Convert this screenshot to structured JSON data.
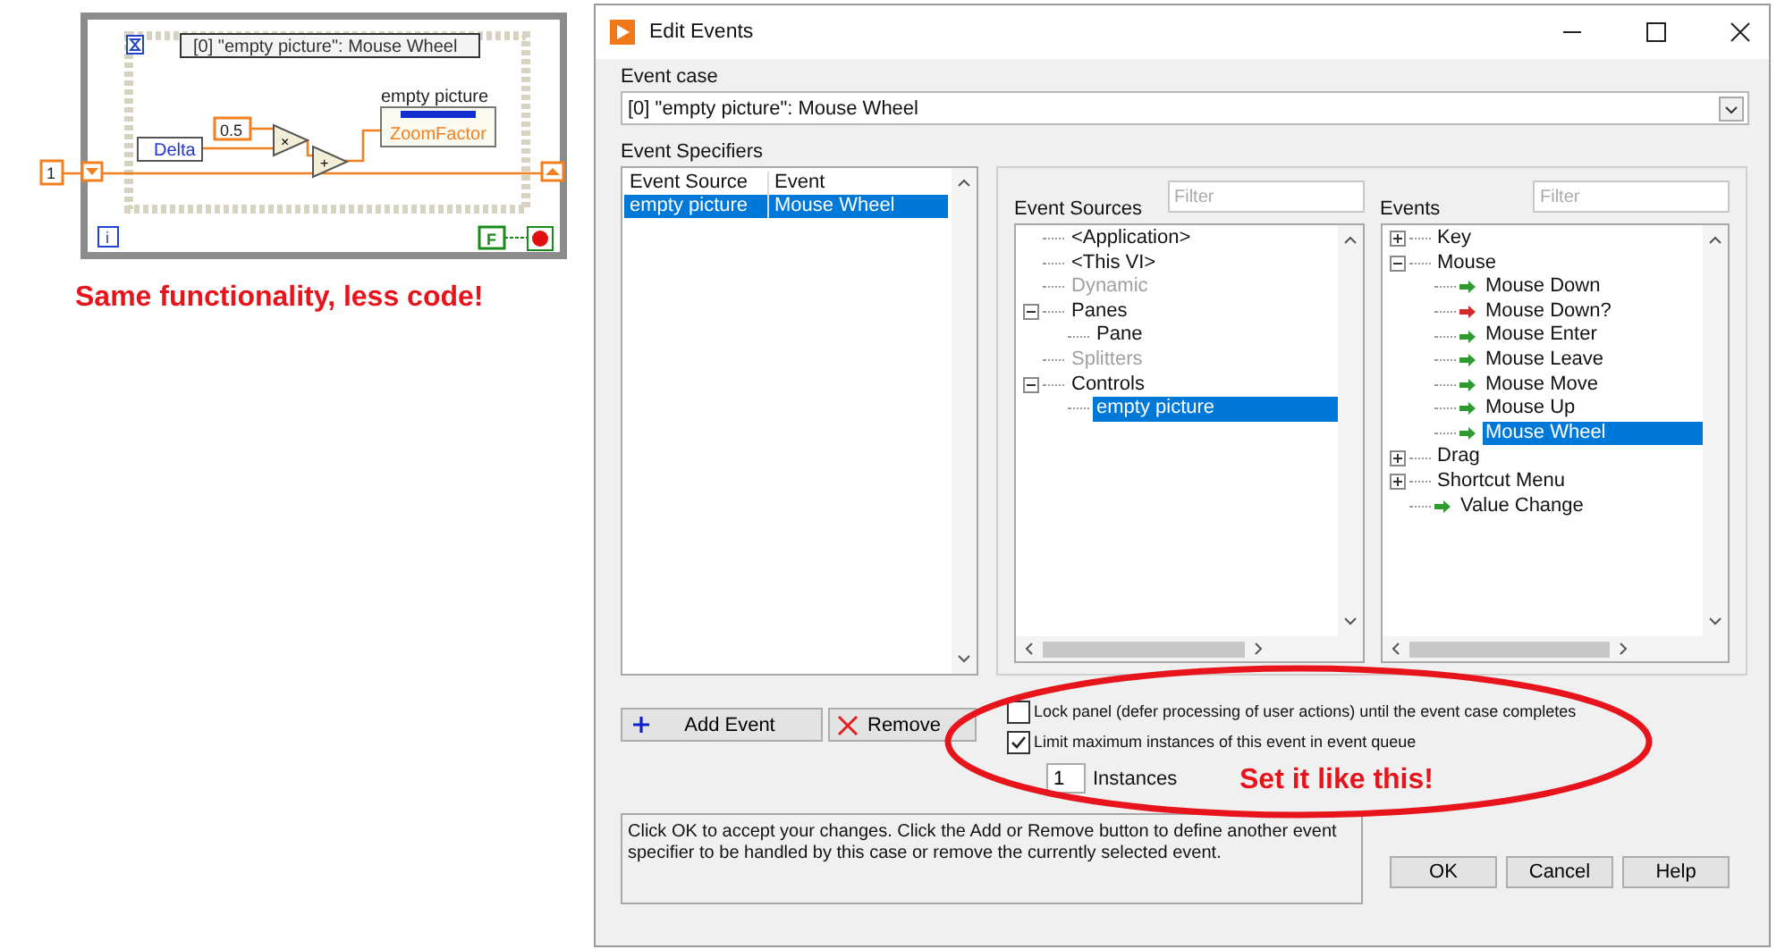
{
  "diagram": {
    "case_selector": "[0] \"empty picture\": Mouse Wheel",
    "indicator_label": "empty picture",
    "property": "ZoomFactor",
    "event_data": "Delta",
    "constant": "0.5",
    "initial": "1",
    "stop_constant": "F",
    "multiply": "×",
    "add": "+",
    "iteration": "i"
  },
  "caption": "Same functionality, less code!",
  "window": {
    "title": "Edit Events"
  },
  "event_case": {
    "label": "Event case",
    "value": "[0] \"empty picture\": Mouse Wheel"
  },
  "specifiers": {
    "label": "Event Specifiers",
    "columns": [
      "Event Source",
      "Event"
    ],
    "rows": [
      {
        "cells": [
          "empty picture",
          "Mouse Wheel"
        ],
        "selected": true
      }
    ]
  },
  "sources": {
    "label": "Event Sources",
    "placeholder": "Filter",
    "items": [
      {
        "label": "<Application>",
        "disabled": false,
        "selected": false
      },
      {
        "label": "<This VI>",
        "disabled": false,
        "selected": false
      },
      {
        "label": "Dynamic",
        "disabled": true,
        "selected": false
      },
      {
        "label": "Panes",
        "disabled": false,
        "selected": false,
        "expanded": true,
        "children": [
          {
            "label": "Pane",
            "disabled": false,
            "selected": false
          }
        ]
      },
      {
        "label": "Splitters",
        "disabled": true,
        "selected": false
      },
      {
        "label": "Controls",
        "disabled": false,
        "selected": false,
        "expanded": true,
        "children": [
          {
            "label": "empty picture",
            "disabled": false,
            "selected": true
          }
        ]
      }
    ]
  },
  "events": {
    "label": "Events",
    "placeholder": "Filter",
    "items": [
      {
        "label": "Key",
        "selected": false,
        "expanded": false
      },
      {
        "label": "Mouse",
        "selected": false,
        "expanded": true,
        "children": [
          {
            "label": "Mouse Down",
            "selected": false,
            "color": "#2f9a2f"
          },
          {
            "label": "Mouse Down?",
            "selected": false,
            "color": "#d42a2a"
          },
          {
            "label": "Mouse Enter",
            "selected": false,
            "color": "#2f9a2f"
          },
          {
            "label": "Mouse Leave",
            "selected": false,
            "color": "#2f9a2f"
          },
          {
            "label": "Mouse Move",
            "selected": false,
            "color": "#2f9a2f"
          },
          {
            "label": "Mouse Up",
            "selected": false,
            "color": "#2f9a2f"
          },
          {
            "label": "Mouse Wheel",
            "selected": true,
            "color": "#2f9a2f"
          }
        ]
      },
      {
        "label": "Drag",
        "selected": false,
        "expanded": false
      },
      {
        "label": "Shortcut Menu",
        "selected": false,
        "expanded": false
      },
      {
        "label": "Value Change",
        "selected": false,
        "color": "#2f9a2f"
      }
    ]
  },
  "add_button": "Add Event",
  "remove_button": "Remove",
  "options": [
    {
      "label": "Lock panel (defer processing of user actions) until the event case completes",
      "checked": false
    },
    {
      "label": "Limit maximum instances of this event in event queue",
      "checked": true
    }
  ],
  "instances": {
    "value": "1",
    "label": "Instances"
  },
  "annotation": "Set it like this!",
  "help_text": "Click OK to accept your changes.  Click the Add or Remove button to define another event specifier to be handled by this case or remove the currently selected event.",
  "dialog_buttons": [
    "OK",
    "Cancel",
    "Help"
  ]
}
